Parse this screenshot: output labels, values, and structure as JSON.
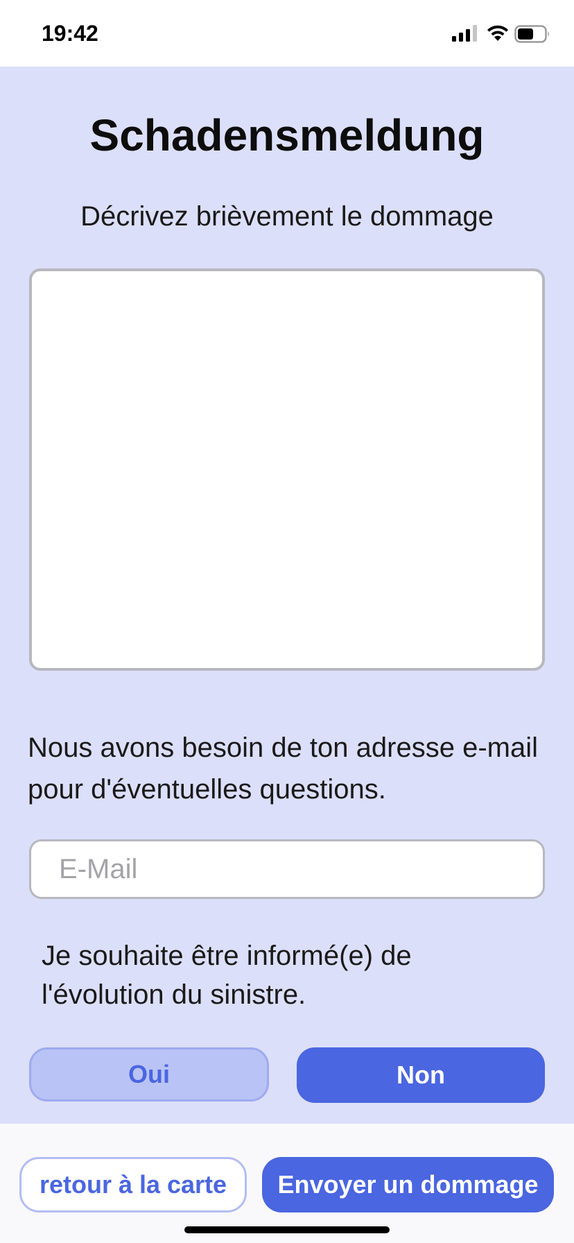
{
  "status_bar": {
    "time": "19:42",
    "icons": [
      "signal-icon",
      "wifi-icon",
      "battery-icon"
    ]
  },
  "form": {
    "title": "Schadensmeldung",
    "description_label": "Décrivez brièvement le dommage",
    "description_value": "",
    "email_info": "Nous avons besoin de ton adresse e-mail pour d'éventuelles questions.",
    "email_placeholder": "E-Mail",
    "email_value": "",
    "notify_text": "Je souhaite être informé(e) de l'évolution du sinistre.",
    "yes_label": "Oui",
    "no_label": "Non",
    "selected_option": "Non"
  },
  "bottom_bar": {
    "back_label": "retour à la carte",
    "send_label": "Envoyer un dommage"
  },
  "colors": {
    "panel_background": "#dcdff9",
    "accent": "#4a66e0",
    "accent_light": "#b9c3f5"
  }
}
